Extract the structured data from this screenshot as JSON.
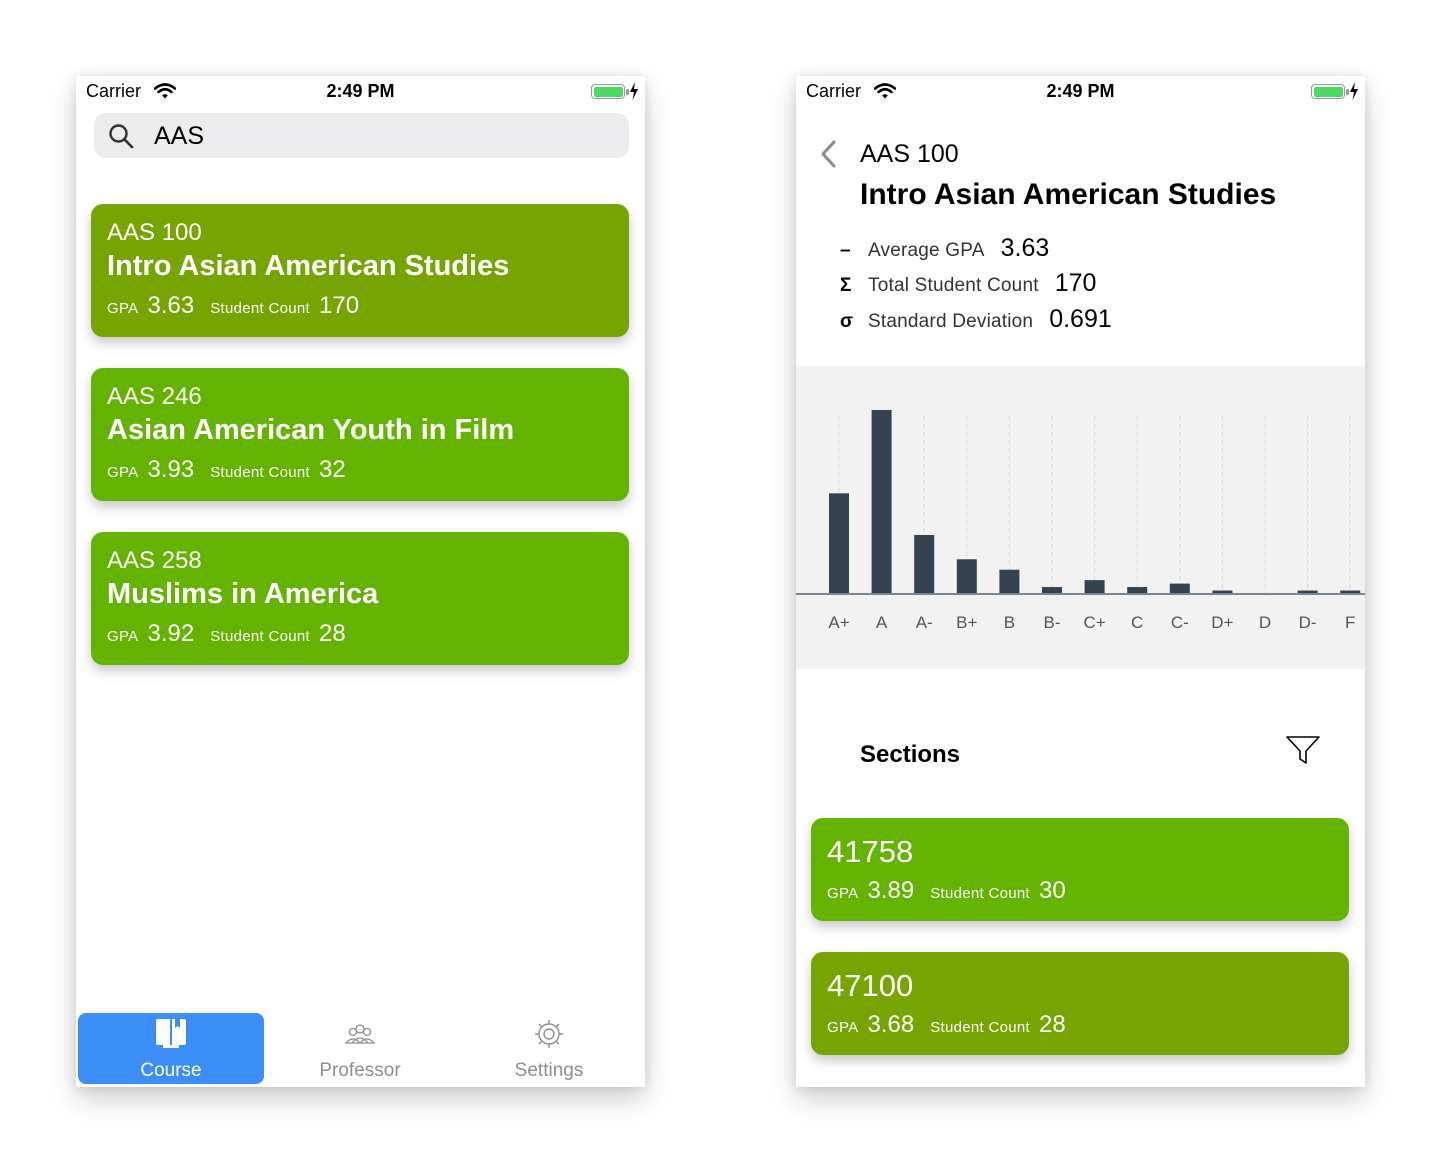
{
  "status": {
    "carrier": "Carrier",
    "time": "2:49 PM"
  },
  "colors": {
    "card_dark": "#76a502",
    "card_bright": "#63b300",
    "tab_active": "#3a8ef6",
    "bar": "#34434f",
    "chart_bg": "#f2f2f2"
  },
  "search": {
    "value": "AAS",
    "placeholder": ""
  },
  "courses": [
    {
      "code": "AAS 100",
      "title": "Intro Asian American Studies",
      "gpa_label": "GPA",
      "gpa": "3.63",
      "count_label": "Student Count",
      "count": "170",
      "color": "#76a502"
    },
    {
      "code": "AAS 246",
      "title": "Asian American Youth in Film",
      "gpa_label": "GPA",
      "gpa": "3.93",
      "count_label": "Student Count",
      "count": "32",
      "color": "#63b300"
    },
    {
      "code": "AAS 258",
      "title": "Muslims in America",
      "gpa_label": "GPA",
      "gpa": "3.92",
      "count_label": "Student Count",
      "count": "28",
      "color": "#63b300"
    }
  ],
  "tabs": [
    {
      "label": "Course",
      "icon": "book-icon",
      "active": true
    },
    {
      "label": "Professor",
      "icon": "people-icon",
      "active": false
    },
    {
      "label": "Settings",
      "icon": "gear-icon",
      "active": false
    }
  ],
  "detail": {
    "code": "AAS 100",
    "title": "Intro Asian American Studies",
    "metrics": [
      {
        "symbol": "–",
        "label": "Average GPA",
        "value": "3.63"
      },
      {
        "symbol": "Σ",
        "label": "Total Student Count",
        "value": "170"
      },
      {
        "symbol": "σ",
        "label": "Standard Deviation",
        "value": "0.691"
      }
    ],
    "sections_title": "Sections",
    "sections": [
      {
        "id": "41758",
        "gpa_label": "GPA",
        "gpa": "3.89",
        "count_label": "Student Count",
        "count": "30",
        "color": "#63b300"
      },
      {
        "id": "47100",
        "gpa_label": "GPA",
        "gpa": "3.68",
        "count_label": "Student Count",
        "count": "28",
        "color": "#76a502"
      }
    ]
  },
  "chart_data": {
    "type": "bar",
    "categories": [
      "A+",
      "A",
      "A-",
      "B+",
      "B",
      "B-",
      "C+",
      "C",
      "C-",
      "D+",
      "D",
      "D-",
      "F"
    ],
    "values": [
      29,
      53,
      17,
      10,
      7,
      2,
      4,
      2,
      3,
      1,
      0,
      1,
      1
    ],
    "title": "",
    "xlabel": "",
    "ylabel": "",
    "ylim": [
      0,
      53
    ],
    "grid": "vertical-dashed",
    "legend": "none"
  }
}
